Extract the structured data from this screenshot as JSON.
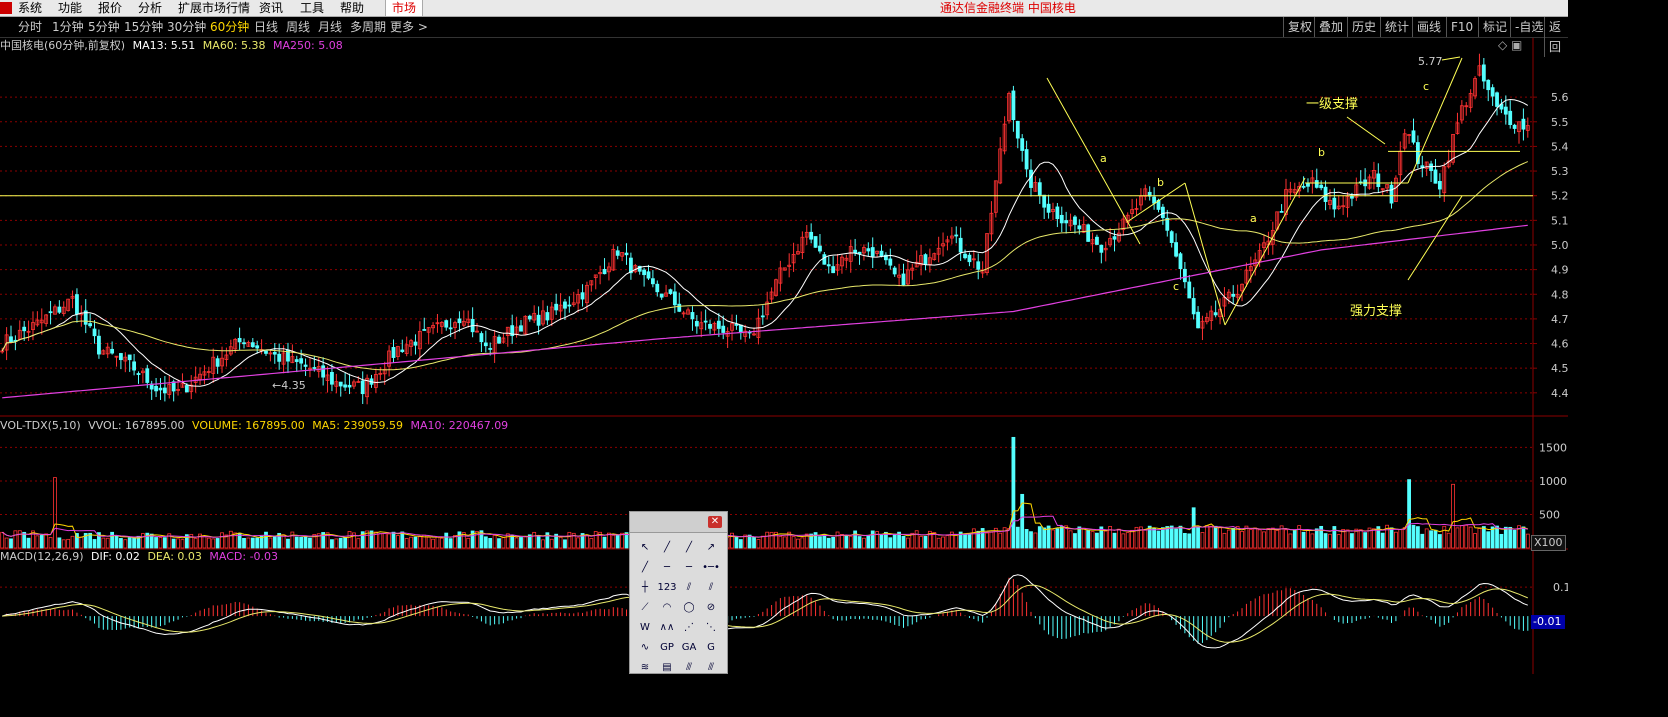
{
  "menubar": {
    "items": [
      "系统",
      "功能",
      "报价",
      "分析",
      "扩展市场行情",
      "资讯",
      "工具",
      "帮助"
    ],
    "market_tab": "市场",
    "app_title": "通达信金融终端  中国核电"
  },
  "toolbar": {
    "periods": [
      "分时",
      "1分钟",
      "5分钟",
      "15分钟",
      "30分钟",
      "60分钟",
      "日线",
      "周线",
      "月线",
      "多周期",
      "更多 >"
    ],
    "active_period": "60分钟",
    "right_items": [
      "复权",
      "叠加",
      "历史",
      "统计",
      "画线",
      "F10",
      "标记",
      "-自选",
      "返回"
    ]
  },
  "colors": {
    "up": "#ff3232",
    "down": "#54ffff",
    "ma13": "#ffffff",
    "ma60": "#e8e86a",
    "ma250": "#e040e0",
    "grid": "#8b0000",
    "annotation": "#ffff55"
  },
  "main_header": {
    "name": "中国核电(60分钟,前复权)",
    "ma13": "MA13: 5.51",
    "ma60": "MA60: 5.38",
    "ma250": "MA250: 5.08"
  },
  "vol_header": {
    "name": "VOL-TDX(5,10)",
    "vvol": "VVOL: 167895.00",
    "volume": "VOLUME: 167895.00",
    "ma5": "MA5: 239059.59",
    "ma10": "MA10: 220467.09"
  },
  "macd_header": {
    "name": "MACD(12,26,9)",
    "dif": "DIF: 0.02",
    "dea": "DEA: 0.03",
    "macd": "MACD: -0.03"
  },
  "annotations": {
    "low_label": "←4.35",
    "high_label": "5.77",
    "level1": "一级支撑",
    "strong": "强力支撑",
    "wave_labels": [
      "a",
      "b",
      "c",
      "a",
      "b",
      "c"
    ],
    "vol_unit": "X100",
    "macd_last": "-0.01"
  },
  "chart_data": {
    "type": "candlestick",
    "price_axis": {
      "ticks": [
        4.4,
        4.5,
        4.6,
        4.7,
        4.8,
        4.9,
        5.0,
        5.1,
        5.2,
        5.3,
        5.4,
        5.5,
        5.6
      ],
      "ylim": [
        4.31,
        5.84
      ]
    },
    "volume_axis": {
      "ticks": [
        500,
        1000,
        1500
      ],
      "unit": "X100",
      "ylim": [
        0,
        1730
      ]
    },
    "macd_axis": {
      "ticks": [
        0.1
      ],
      "ylim": [
        -0.2,
        0.18
      ]
    },
    "price_path": [
      [
        0,
        4.6
      ],
      [
        8,
        4.68
      ],
      [
        16,
        4.78
      ],
      [
        22,
        4.58
      ],
      [
        30,
        4.5
      ],
      [
        35,
        4.42
      ],
      [
        40,
        4.4
      ],
      [
        48,
        4.52
      ],
      [
        55,
        4.62
      ],
      [
        62,
        4.55
      ],
      [
        70,
        4.5
      ],
      [
        76,
        4.44
      ],
      [
        82,
        4.42
      ],
      [
        90,
        4.58
      ],
      [
        98,
        4.65
      ],
      [
        105,
        4.72
      ],
      [
        110,
        4.58
      ],
      [
        118,
        4.68
      ],
      [
        125,
        4.72
      ],
      [
        133,
        4.82
      ],
      [
        140,
        4.98
      ],
      [
        146,
        4.85
      ],
      [
        152,
        4.78
      ],
      [
        158,
        4.68
      ],
      [
        165,
        4.66
      ],
      [
        170,
        4.62
      ],
      [
        177,
        4.88
      ],
      [
        183,
        5.05
      ],
      [
        188,
        4.9
      ],
      [
        193,
        4.98
      ],
      [
        198,
        4.98
      ],
      [
        204,
        4.85
      ],
      [
        210,
        4.95
      ],
      [
        215,
        5.05
      ],
      [
        220,
        4.95
      ],
      [
        223,
        4.9
      ],
      [
        226,
        5.25
      ],
      [
        229,
        5.62
      ],
      [
        233,
        5.28
      ],
      [
        238,
        5.15
      ],
      [
        244,
        5.08
      ],
      [
        250,
        5.0
      ],
      [
        255,
        5.08
      ],
      [
        260,
        5.2
      ],
      [
        264,
        5.12
      ],
      [
        268,
        4.9
      ],
      [
        272,
        4.65
      ],
      [
        276,
        4.72
      ],
      [
        280,
        4.8
      ],
      [
        286,
        4.95
      ],
      [
        292,
        5.2
      ],
      [
        298,
        5.25
      ],
      [
        303,
        5.15
      ],
      [
        308,
        5.22
      ],
      [
        312,
        5.28
      ],
      [
        316,
        5.2
      ],
      [
        319,
        5.48
      ],
      [
        322,
        5.35
      ],
      [
        327,
        5.25
      ],
      [
        332,
        5.55
      ],
      [
        336,
        5.7
      ],
      [
        340,
        5.55
      ],
      [
        344,
        5.5
      ],
      [
        347,
        5.48
      ]
    ],
    "ma250_path": [
      [
        0,
        4.38
      ],
      [
        150,
        4.62
      ],
      [
        230,
        4.73
      ],
      [
        300,
        4.98
      ],
      [
        347,
        5.08
      ]
    ],
    "last": {
      "ma13": 5.51,
      "ma60": 5.38,
      "ma250": 5.08,
      "low": 4.35,
      "high": 5.77
    },
    "support_lines": [
      5.2,
      5.38
    ],
    "volume_spikes": [
      [
        12,
        1050
      ],
      [
        105,
        230
      ],
      [
        230,
        1650
      ],
      [
        232,
        800
      ],
      [
        271,
        600
      ],
      [
        320,
        1020
      ],
      [
        330,
        950
      ]
    ],
    "macd_last": {
      "dif": 0.02,
      "dea": 0.03,
      "macd": -0.03
    }
  }
}
